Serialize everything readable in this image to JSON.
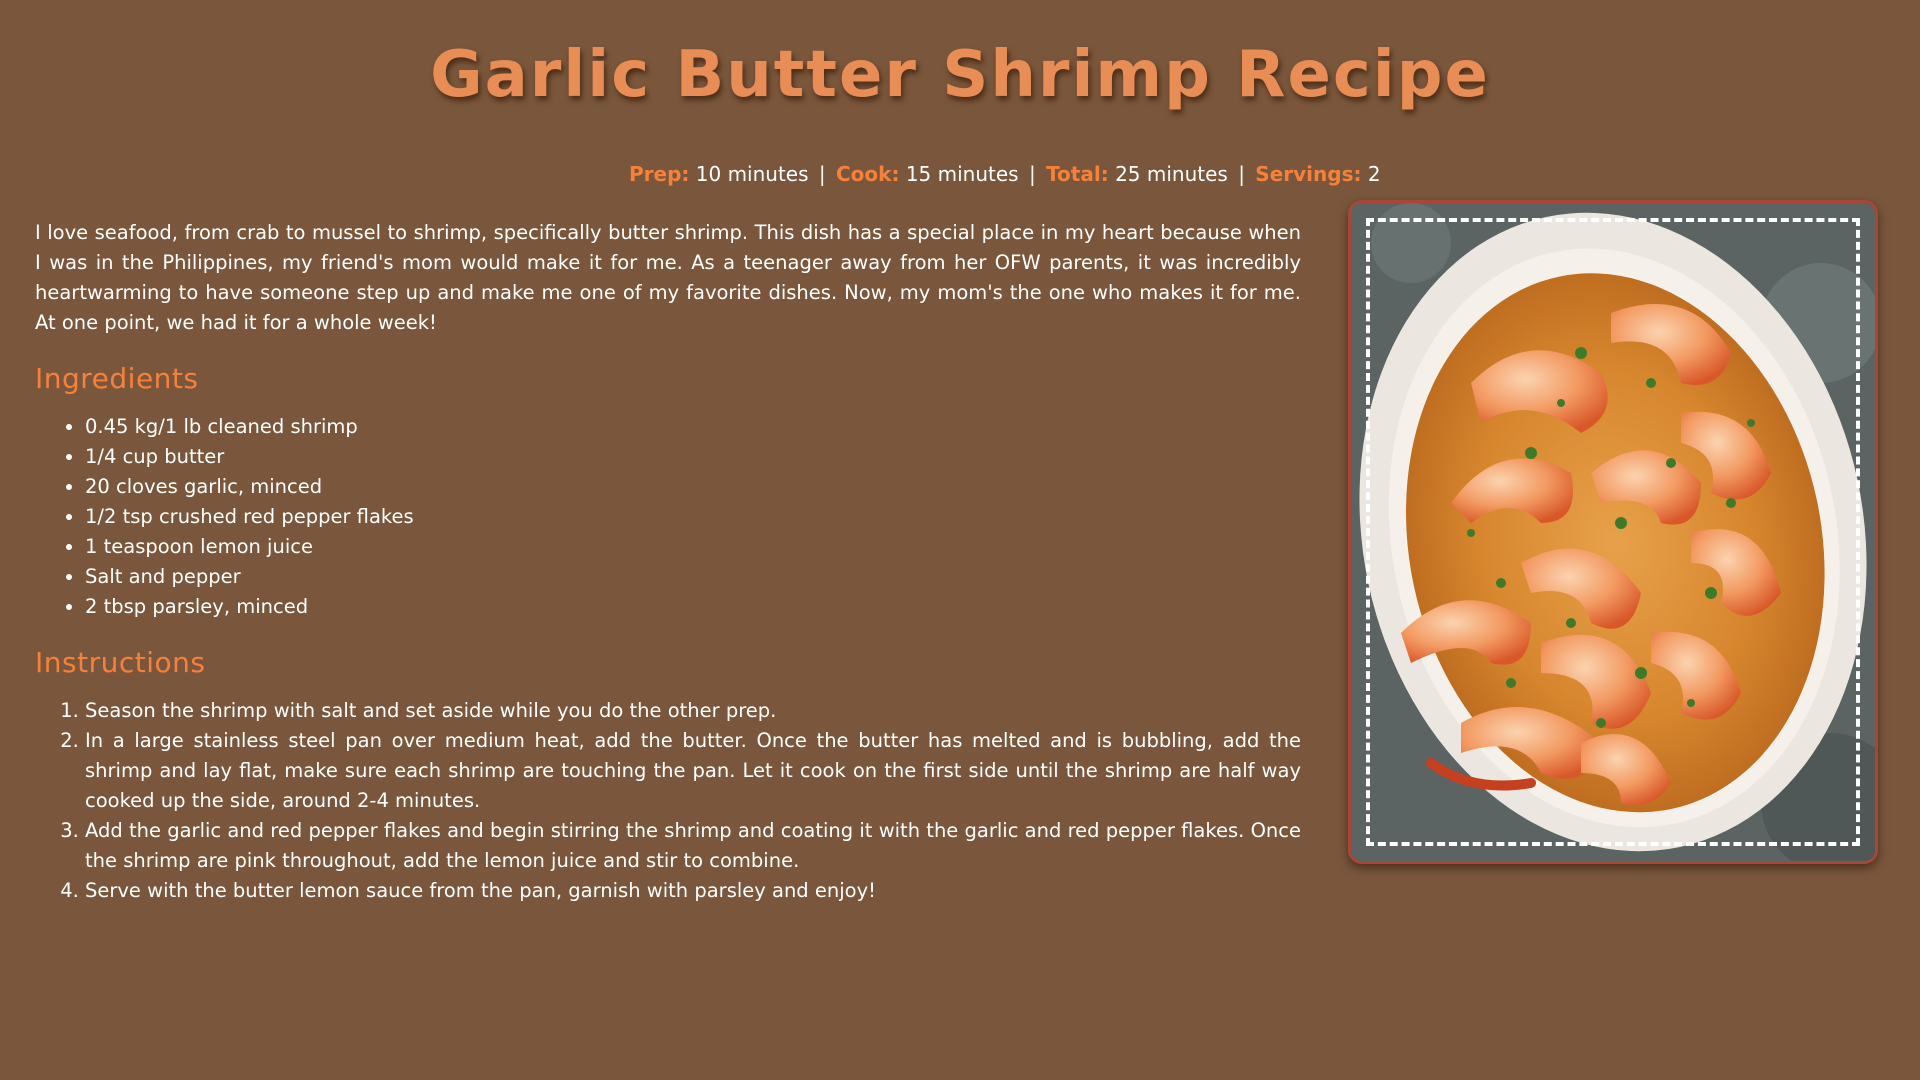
{
  "title": "Garlic Butter Shrimp Recipe",
  "meta": {
    "prep_label": "Prep:",
    "prep_value": "10 minutes",
    "cook_label": "Cook:",
    "cook_value": "15 minutes",
    "total_label": "Total:",
    "total_value": "25 minutes",
    "servings_label": "Servings:",
    "servings_value": "2",
    "separator": "|"
  },
  "intro": "I love seafood, from crab to mussel to shrimp, specifically butter shrimp. This dish has a special place in my heart because when I was in the Philippines, my friend's mom would make it for me. As a teenager away from her OFW parents, it was incredibly heartwarming to have someone step up and make me one of my favorite dishes. Now, my mom's the one who makes it for me. At one point, we had it for a whole week!",
  "ingredients": {
    "heading": "Ingredients",
    "items": [
      "0.45 kg/1 lb cleaned shrimp",
      "1/4 cup butter",
      "20 cloves garlic, minced",
      "1/2 tsp crushed red pepper flakes",
      "1 teaspoon lemon juice",
      "Salt and pepper",
      "2 tbsp parsley, minced"
    ]
  },
  "instructions": {
    "heading": "Instructions",
    "steps": [
      "Season the shrimp with salt and set aside while you do the other prep.",
      "In a large stainless steel pan over medium heat, add the butter. Once the butter has melted and is bubbling, add the shrimp and lay flat, make sure each shrimp are touching the pan. Let it cook on the first side until the shrimp are half way cooked up the side, around 2-4 minutes.",
      "Add the garlic and red pepper flakes and begin stirring the shrimp and coating it with the garlic and red pepper flakes. Once the shrimp are pink throughout, add the lemon juice and stir to combine.",
      "Serve with the butter lemon sauce from the pan, garnish with parsley and enjoy!"
    ]
  },
  "colors": {
    "background": "#7a573c",
    "accent": "#f5813a",
    "title": "#e88d55",
    "photo_border": "#a6473a"
  }
}
